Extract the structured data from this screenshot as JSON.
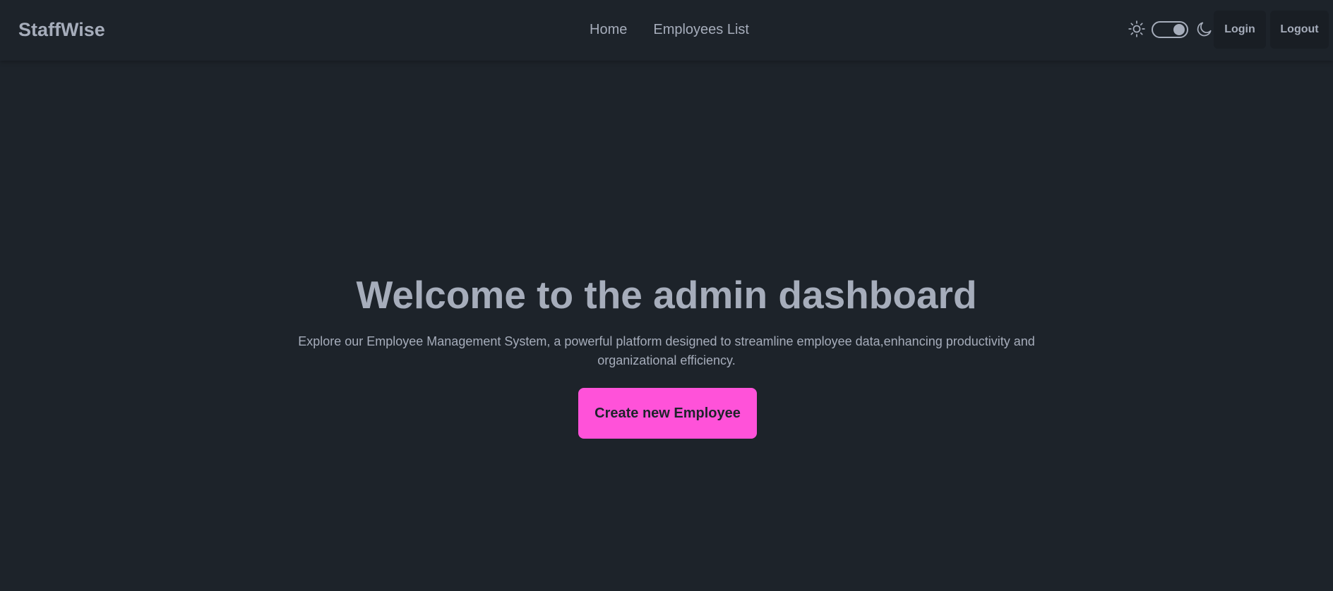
{
  "header": {
    "brand": "StaffWise",
    "nav": [
      "Home",
      "Employees List"
    ],
    "theme_toggle": {
      "left_icon": "sun-icon",
      "right_icon": "moon-icon",
      "state": "dark"
    },
    "login_label": "Login",
    "logout_label": "Logout"
  },
  "hero": {
    "title": "Welcome to the admin dashboard",
    "description": "Explore our Employee Management System, a powerful platform designed to streamline employee data,enhancing productivity and organizational efficiency.",
    "cta_label": "Create new Employee"
  },
  "colors": {
    "background": "#1d232a",
    "text": "#a6adbb",
    "accent": "#ff52d9",
    "button_bg": "#191e24"
  }
}
